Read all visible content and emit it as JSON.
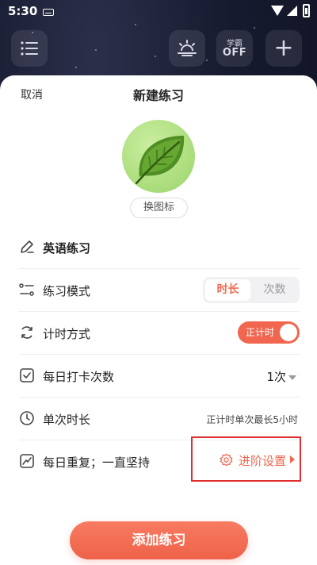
{
  "status_bar": {
    "time": "5:30"
  },
  "toolbar": {
    "list_icon": "list-icon",
    "sunrise_icon": "sunrise-icon",
    "study_mode_top": "学霸",
    "study_mode_state": "OFF",
    "add_icon": "plus-icon",
    "add_glyph": "+"
  },
  "sheet": {
    "cancel_label": "取消",
    "title": "新建练习",
    "icon_name": "leaf-icon",
    "change_icon_label": "换图标",
    "name_row": {
      "icon": "pencil-icon",
      "label": "英语练习"
    },
    "mode_row": {
      "icon": "mode-list-icon",
      "label": "练习模式",
      "options": [
        "时长",
        "次数"
      ],
      "selected": "时长"
    },
    "timing_row": {
      "icon": "refresh-icon",
      "label": "计时方式",
      "toggle_label": "正计时",
      "toggle_on": true
    },
    "daily_row": {
      "icon": "checkbox-icon",
      "label": "每日打卡次数",
      "value": "1次"
    },
    "duration_row": {
      "icon": "clock-icon",
      "label": "单次时长",
      "hint": "正计时单次最长5小时"
    },
    "repeat_row": {
      "icon": "trend-icon",
      "label": "每日重复；一直坚持",
      "advanced_label": "进阶设置",
      "advanced_icon": "gear-icon"
    },
    "submit_label": "添加练习"
  },
  "colors": {
    "accent": "#f0664f",
    "highlight_border": "#e02d2d",
    "background": "#14172a"
  }
}
